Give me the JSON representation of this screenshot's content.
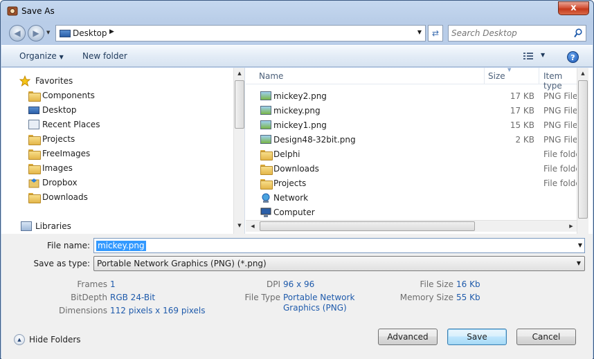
{
  "window": {
    "title": "Save As",
    "close_label": "x"
  },
  "address": {
    "location": "Desktop"
  },
  "search": {
    "placeholder": "Search Desktop"
  },
  "toolbar": {
    "organize_label": "Organize",
    "new_folder_label": "New folder",
    "help_label": "?"
  },
  "nav_pane": {
    "favorites_label": "Favorites",
    "items": [
      {
        "label": "Components",
        "icon": "folder-icon"
      },
      {
        "label": "Desktop",
        "icon": "desktop-icon"
      },
      {
        "label": "Recent Places",
        "icon": "recent-places-icon"
      },
      {
        "label": "Projects",
        "icon": "folder-icon"
      },
      {
        "label": "FreeImages",
        "icon": "folder-icon"
      },
      {
        "label": "Images",
        "icon": "folder-icon"
      },
      {
        "label": "Dropbox",
        "icon": "dropbox-icon"
      },
      {
        "label": "Downloads",
        "icon": "downloads-icon"
      }
    ],
    "libraries_label": "Libraries"
  },
  "file_list": {
    "columns": {
      "name": "Name",
      "size": "Size",
      "type": "Item type"
    },
    "rows": [
      {
        "name": "mickey2.png",
        "size": "17 KB",
        "type": "PNG File",
        "icon": "png-file-icon"
      },
      {
        "name": "mickey.png",
        "size": "17 KB",
        "type": "PNG File",
        "icon": "png-file-icon"
      },
      {
        "name": "mickey1.png",
        "size": "15 KB",
        "type": "PNG File",
        "icon": "png-file-icon"
      },
      {
        "name": "Design48-32bit.png",
        "size": "2 KB",
        "type": "PNG File",
        "icon": "png-file-icon"
      },
      {
        "name": "Delphi",
        "size": "",
        "type": "File folder",
        "icon": "folder-icon"
      },
      {
        "name": "Downloads",
        "size": "",
        "type": "File folder",
        "icon": "downloads-icon"
      },
      {
        "name": "Projects",
        "size": "",
        "type": "File folder",
        "icon": "folder-icon"
      },
      {
        "name": "Network",
        "size": "",
        "type": "",
        "icon": "network-icon"
      },
      {
        "name": "Computer",
        "size": "",
        "type": "",
        "icon": "computer-icon"
      }
    ]
  },
  "form": {
    "file_name_label": "File name:",
    "file_name_value": "mickey.png",
    "save_type_label": "Save as type:",
    "save_type_value": "Portable Network Graphics (PNG) (*.png)"
  },
  "metadata": {
    "frames_label": "Frames",
    "frames_value": "1",
    "bitdepth_label": "BitDepth",
    "bitdepth_value": "RGB 24-Bit",
    "dimensions_label": "Dimensions",
    "dimensions_value": "112 pixels x 169 pixels",
    "dpi_label": "DPI",
    "dpi_value": "96 x 96",
    "filetype_label": "File Type",
    "filetype_value_line1": "Portable Network",
    "filetype_value_line2": "Graphics (PNG)",
    "filesize_label": "File Size",
    "filesize_value": "16 Kb",
    "memsize_label": "Memory Size",
    "memsize_value": "55 Kb"
  },
  "buttons": {
    "hide_folders": "Hide Folders",
    "advanced": "Advanced",
    "save": "Save",
    "cancel": "Cancel"
  }
}
